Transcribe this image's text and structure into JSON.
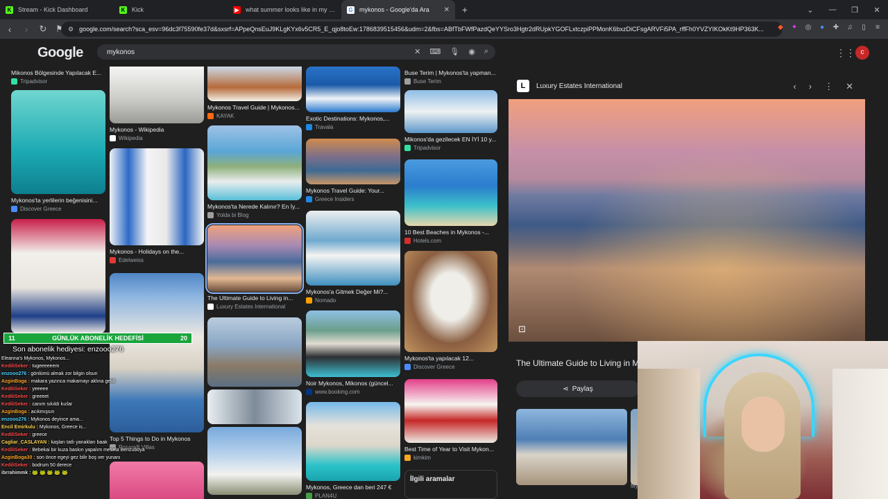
{
  "browser": {
    "tabs": [
      {
        "label": "Stream - Kick Dashboard",
        "icon": "kick-icon",
        "color": "#53fc18"
      },
      {
        "label": "Kick",
        "icon": "kick-icon",
        "color": "#53fc18"
      },
      {
        "label": "what summer looks like in my 20s - Y",
        "icon": "youtube-icon",
        "color": "#ff0000"
      },
      {
        "label": "mykonos - Google'da Ara",
        "icon": "google-icon",
        "color": "#ffffff",
        "active": true
      }
    ],
    "url": "google.com/search?sca_esv=96dc3f75590fe37d&sxsrf=APpeQnsEuJ9KLgKYx6v5CR5_E_qjo8toEw:1786839515456&udm=2&fbs=ABfTbFWfPazdQeYYSro3Hgtr2dRUpkYGOFLxtczpiPPMonK6bxzDiCFsgARVFi5PA_rffFh0YVZYIKOkKt9HP363K..."
  },
  "google": {
    "logo": "Google",
    "query": "mykonos",
    "avatar": "c"
  },
  "grid": [
    {
      "cap": "Mikonos Bölgesinde Yapılacak E...",
      "src": "Tripadvisor",
      "srcColor": "#34e0a1"
    },
    {
      "cap": "Mykonos'ta yerlilerin beğenisini...",
      "src": "Discover Greece",
      "srcColor": "#4a8cff"
    },
    {
      "cap": "Mykonos - Wikipedia",
      "src": "Wikipedia",
      "srcColor": "#ffffff"
    },
    {
      "cap": "Mykonos - Holidays on the...",
      "src": "Edelweiss",
      "srcColor": "#e53935"
    },
    {
      "cap": "Top 5 Things to Do in Mykonos",
      "src": "Posarelli Villas",
      "srcColor": "#9e9e9e"
    },
    {
      "cap": "Mykonos Travel Guide | Mykonos...",
      "src": "KAYAK",
      "srcColor": "#ff690f"
    },
    {
      "cap": "Mykonos'ta Nerede Kalınır? En İy...",
      "src": "Yolda bi Blog",
      "srcColor": "#9e9e9e"
    },
    {
      "cap": "The Ultimate Guide to Living in...",
      "src": "Luxury Estates International",
      "srcColor": "#ffffff"
    },
    {
      "cap": "Exotic Destinations: Mykonos,...",
      "src": "Travala",
      "srcColor": "#1e88e5"
    },
    {
      "cap": "Mykonos Travel Guide: Your...",
      "src": "Greece Insiders",
      "srcColor": "#1e88e5"
    },
    {
      "cap": "Mykonos'a Gitmek Değer Mi?...",
      "src": "Nomado",
      "srcColor": "#ffa000"
    },
    {
      "cap": "Noir Mykonos, Mikonos (güncel...",
      "src": "www.booking.com",
      "srcColor": "#003580"
    },
    {
      "cap": "Mykonos, Greece dan beri 247 €",
      "src": "PLAN4U",
      "srcColor": "#43a047"
    },
    {
      "cap": "Buse Terim | Mykonos'ta yapman...",
      "src": "Buse Terim",
      "srcColor": "#9e9e9e"
    },
    {
      "cap": "Mikonos'da gezilecek EN İYİ 10 y...",
      "src": "Tripadvisor",
      "srcColor": "#34e0a1"
    },
    {
      "cap": "10 Best Beaches in Mykonos -...",
      "src": "Hotels.com",
      "srcColor": "#d32f2f"
    },
    {
      "cap": "Mykonos'ta yapılacak 12...",
      "src": "Discover Greece",
      "srcColor": "#4a8cff"
    },
    {
      "cap": "Best Time of Year to Visit Mykon...",
      "src": "kimkim",
      "srcColor": "#f9a825"
    }
  ],
  "related": "İlgili aramalar",
  "panel": {
    "source": "Luxury Estates International",
    "logo": "L",
    "title": "The Ultimate Guide to Living in M",
    "share": "Paylaş",
    "strip_label": "My"
  },
  "overlay": {
    "goal": {
      "left": "11",
      "label": "GÜNLÜK ABONELİK HEDEFİSİ",
      "right": "20"
    },
    "last_sub": "Son abonelik hediyesi: enzooo276",
    "messages": [
      {
        "user": "",
        "text": "Eleanna's Mykonos, Mykonos..."
      },
      {
        "user": "KediliSeker :",
        "text": "tugeeeeeem"
      },
      {
        "user": "enzooo276 :",
        "text": "gönlümü almak zor bilgin olsun"
      },
      {
        "user": "AzginBoga :",
        "text": "makara yazınca makarnayı aklına geldi"
      },
      {
        "user": "KediliSeker :",
        "text": "yeeeee"
      },
      {
        "user": "KediliSeker :",
        "text": "greeeet"
      },
      {
        "user": "KediliSeker :",
        "text": "canım sıkıldı kızlar"
      },
      {
        "user": "AzginBoga :",
        "text": "acıkmışsın"
      },
      {
        "user": "enzooo276 :",
        "text": "Mykonos deyince ama..."
      },
      {
        "user": "Encil Emirkulu :",
        "text": "Mykonos, Greece is..."
      },
      {
        "user": "KediliSeker :",
        "text": "greece"
      },
      {
        "user": "Cagliar_CASLAYAN :",
        "text": "kaşları tatlı yanakları baak"
      },
      {
        "user": "KediliSeker :",
        "text": "Bebekai bir kuza baskın yapalım mesela Benzuboya"
      },
      {
        "user": "AzginBoga30 :",
        "text": "son önce egeyi gez bilir boş ver yunanı"
      },
      {
        "user": "KediliSeker :",
        "text": "bodrum 50 derece"
      },
      {
        "user": "ibrrahimmk :",
        "text": "🐸 🐸 🐸 🐸 🐸"
      }
    ]
  }
}
